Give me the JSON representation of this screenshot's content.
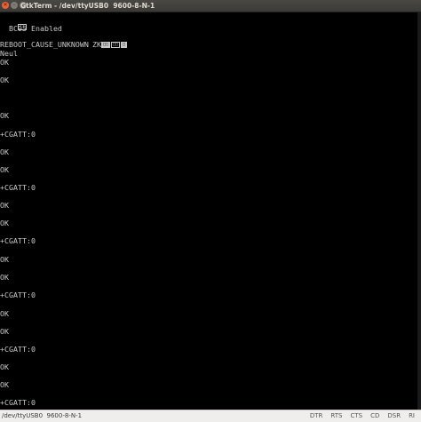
{
  "window": {
    "title": "GtkTerm - /dev/ttyUSB0  9600-8-N-1",
    "controls": [
      "close-icon",
      "minimize-icon",
      "maximize-icon"
    ]
  },
  "terminal": {
    "lines": [
      "",
      "  BC95 Enabled",
      "",
      "REBOOT_CAUSE_UNKNOWN",
      "Neul",
      "OK",
      "OK",
      "OK",
      "+CGATT:0",
      "OK",
      "OK",
      "+CGATT:0",
      "OK",
      "OK",
      "+CGATT:0",
      "OK",
      "OK",
      "+CGATT:0",
      "OK",
      "OK",
      "+CGATT:0",
      "OK",
      "OK",
      "+CGATT:0",
      "OK",
      "OK",
      "+CGATT:0"
    ],
    "zk_text": "ZK"
  },
  "statusbar": {
    "port": "/dev/ttyUSB0  9600-8-N-1",
    "signals": [
      "DTR",
      "RTS",
      "CTS",
      "CD",
      "DSR",
      "RI"
    ]
  }
}
